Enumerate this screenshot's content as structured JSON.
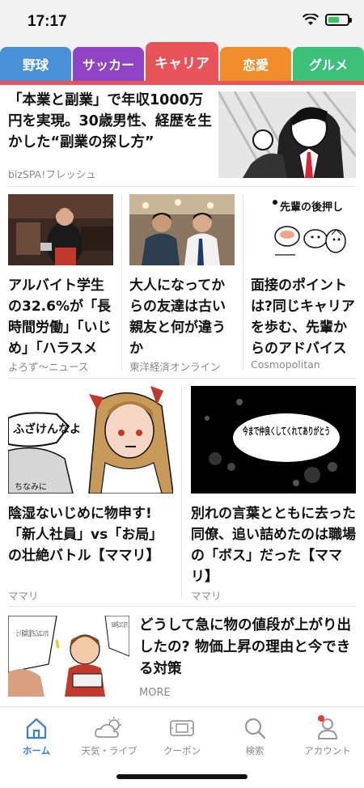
{
  "status_bar": {
    "time": "17:17"
  },
  "tabs": [
    {
      "label": "野球",
      "color": "#4a90d9"
    },
    {
      "label": "サッカー",
      "color": "#8e44c4"
    },
    {
      "label": "キャリア",
      "color": "#e8535a"
    },
    {
      "label": "恋愛",
      "color": "#ef8c2c"
    },
    {
      "label": "グルメ",
      "color": "#3cc07a"
    }
  ],
  "active_tab": "キャリア",
  "hero": {
    "title": "「本業と副業」で年収1000万円を実現。30歳男性、経歴を生かした“副業の探し方”",
    "source": "bizSPA!フレッシュ"
  },
  "row3": [
    {
      "title": "アルバイト学生の32.6%が「長時間労働」「いじめ」「ハラスメン…",
      "source": "よろず〜ニュース"
    },
    {
      "title": "大人になってからの友達は古い親友と何が違うか",
      "source": "東洋経済オンライン"
    },
    {
      "title": "面接のポイントは?同じキャリアを歩む、先輩からのアドバイス",
      "source": "Cosmopolitan",
      "thumb_text": "先輩の後押し"
    }
  ],
  "row2": [
    {
      "title": "陰湿ないじめに物申す!「新人社員」vs「お局」の壮絶バトル【ママリ】",
      "source": "ママリ",
      "bubble": "ふざけんなよ",
      "caption": "ちなみに"
    },
    {
      "title": "別れの言葉とともに去った同僚、追い詰めたのは職場の「ボス」だった【ママリ】",
      "source": "ママリ",
      "bubble": "今まで仲良くしてくれてありがとう"
    }
  ],
  "wide": {
    "title": "どうして急に物の値段が上がり出したの? 物価上昇の理由と今できる対策",
    "more": "MORE",
    "thumb_text_1": "5000円になります!",
    "thumb_text_2": "えっ? 前は同じ量でもこんなにいかな"
  },
  "bottom_nav": [
    {
      "label": "ホーム",
      "icon": "home-icon",
      "active": true
    },
    {
      "label": "天気・ライブ",
      "icon": "weather-icon",
      "active": false
    },
    {
      "label": "クーポン",
      "icon": "coupon-icon",
      "active": false
    },
    {
      "label": "検索",
      "icon": "search-icon",
      "active": false
    },
    {
      "label": "アカウント",
      "icon": "account-icon",
      "active": false
    }
  ],
  "colors": {
    "accent": "#e8535a",
    "nav_active": "#3b7de8"
  }
}
